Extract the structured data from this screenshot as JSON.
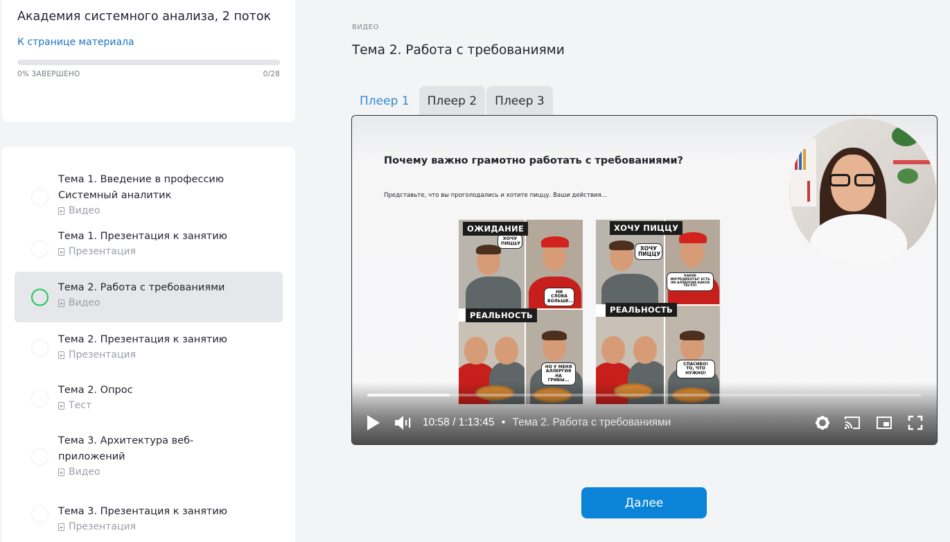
{
  "course": {
    "title": "Академия системного анализа, 2 поток",
    "material_link": "К странице материала",
    "progress_label": "0% ЗАВЕРШЕНО",
    "progress_count": "0/28",
    "progress_fraction": 0
  },
  "lessons": [
    {
      "title": "Тема 1. Введение в профессию Системный аналитик",
      "type": "Видео",
      "type_icon": "video-file-icon",
      "active": false
    },
    {
      "title": "Тема 1. Презентация к занятию",
      "type": "Презентация",
      "type_icon": "presentation-file-icon",
      "active": false
    },
    {
      "title": "Тема 2. Работа с требованиями",
      "type": "Видео",
      "type_icon": "video-file-icon",
      "active": true
    },
    {
      "title": "Тема 2. Презентация к занятию",
      "type": "Презентация",
      "type_icon": "presentation-file-icon",
      "active": false
    },
    {
      "title": "Тема 2. Опрос",
      "type": "Тест",
      "type_icon": "test-file-icon",
      "active": false
    },
    {
      "title": "Тема 3. Архитектура веб-приложений",
      "type": "Видео",
      "type_icon": "video-file-icon",
      "active": false
    },
    {
      "title": "Тема 3. Презентация к занятию",
      "type": "Презентация",
      "type_icon": "presentation-file-icon",
      "active": false
    }
  ],
  "main": {
    "eyebrow": "ВИДЕО",
    "title": "Тема 2. Работа с требованиями",
    "tabs": [
      {
        "label": "Плеер 1",
        "active": true
      },
      {
        "label": "Плеер 2",
        "active": false
      },
      {
        "label": "Плеер 3",
        "active": false
      }
    ],
    "next_button": "Далее"
  },
  "slide": {
    "heading": "Почему важно грамотно работать с требованиями?",
    "text": "Представьте, что вы проголодались и хотите пиццу. Ваши действия...",
    "memes": [
      {
        "top_caption": "ОЖИДАНИЕ",
        "bottom_caption": "РЕАЛЬНОСТЬ",
        "bubble_1": "ХОЧУ ПИЦЦУ",
        "bubble_2": "НИ СЛОВА БОЛЬШЕ...",
        "bubble_3": "НО У МЕНЯ АЛЛЕРГИЯ НА ГРИБЫ..."
      },
      {
        "top_caption": "ХОЧУ ПИЦЦУ",
        "bottom_caption": "РЕАЛЬНОСТЬ",
        "bubble_1": "ХОЧУ ПИЦЦУ",
        "bubble_2": "КАКИЕ ИНГРЕДИЕНТЫ? ЕСТЬ ЛИ АЛЛЕРГИЯ КАКОЕ ТЕСТО?",
        "bubble_3": "СПАСИБО! ТО, ЧТО НУЖНО!"
      }
    ]
  },
  "player": {
    "current_time": "10:58",
    "duration": "/ 1:13:45",
    "separator": "•",
    "video_title": "Тема 2. Работа с требованиями",
    "played_fraction": 0.149,
    "buffered_fraction": 0.149,
    "icons": [
      "play-icon",
      "volume-icon",
      "settings-icon",
      "cast-icon",
      "miniplayer-icon",
      "fullscreen-icon"
    ]
  },
  "colors": {
    "accent_blue": "#0b84d8",
    "link_blue": "#1a73c5",
    "active_tab_text": "#2f8bd4",
    "active_lesson_ring": "#22c55e",
    "active_lesson_bg": "#e6e7ea"
  }
}
